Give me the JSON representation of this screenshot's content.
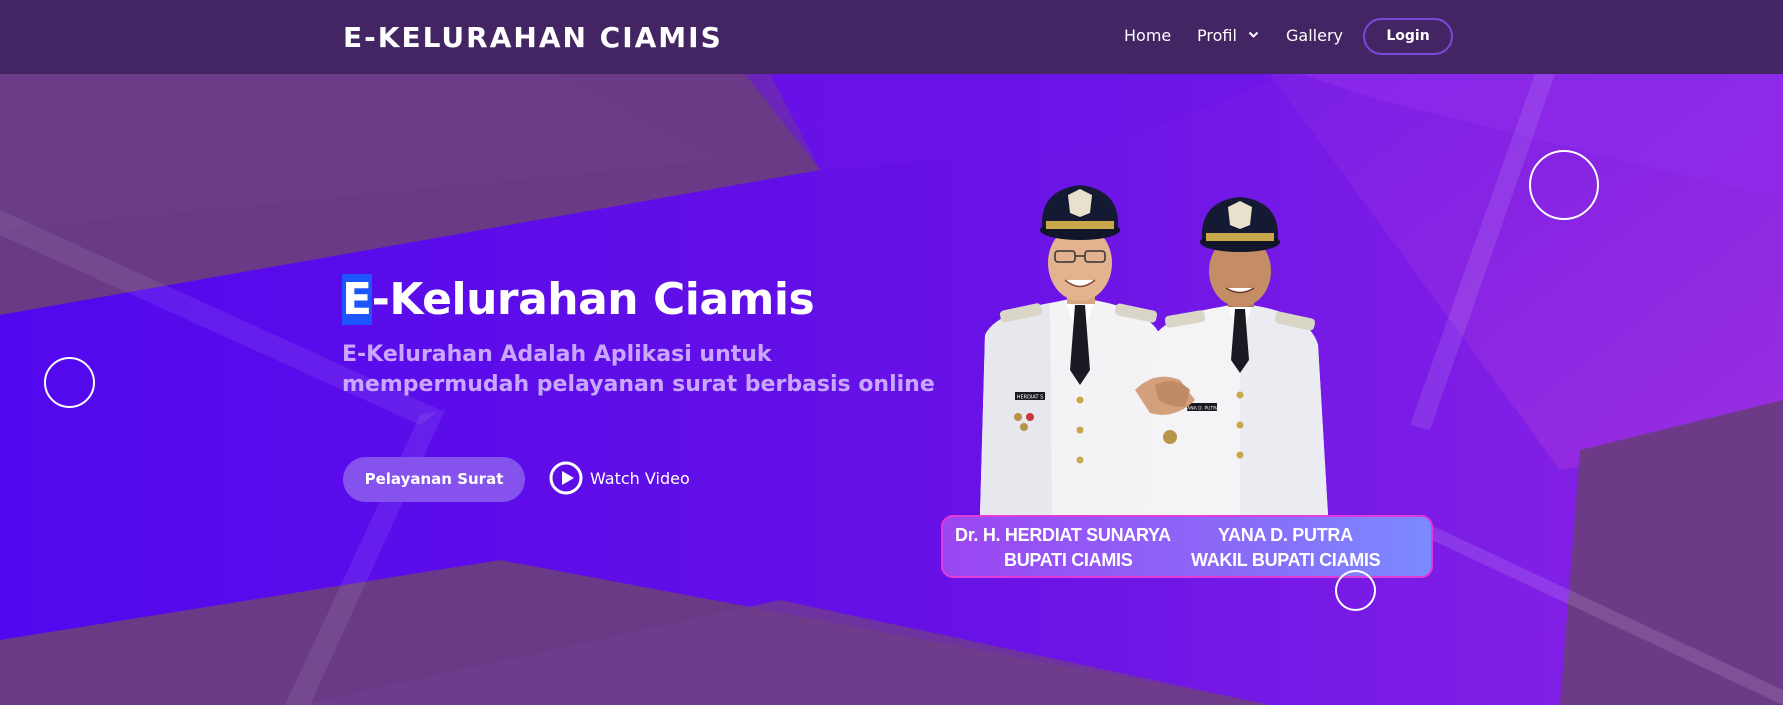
{
  "header": {
    "brand": "E-KELURAHAN CIAMIS",
    "nav": {
      "home": "Home",
      "profil": "Profil",
      "gallery": "Gallery",
      "login": "Login"
    }
  },
  "hero": {
    "title_first_letter": "E",
    "title_rest": "-Kelurahan Ciamis",
    "subtitle_line1": "E-Kelurahan Adalah Aplikasi untuk",
    "subtitle_line2": "mempermudah pelayanan surat berbasis online",
    "cta_label": "Pelayanan Surat",
    "watch_label": "Watch Video"
  },
  "photo": {
    "caption": {
      "name_1": "Dr. H. HERDIAT SUNARYA",
      "role_1": "BUPATI CIAMIS",
      "name_2": "YANA D. PUTRA",
      "role_2": "WAKIL BUPATI CIAMIS"
    },
    "badge_1": "HERDIAT S",
    "badge_2": "YANA D. PUTRA"
  },
  "colors": {
    "header_bg": "#432564",
    "hero_bg": "#5a10e8",
    "accent_button": "#8552ee",
    "subtitle": "#c9a6ff",
    "selection": "#1d56ff"
  },
  "icons": {
    "profil_dropdown": "chevron-down-icon",
    "watch_video": "play-circle-icon"
  }
}
